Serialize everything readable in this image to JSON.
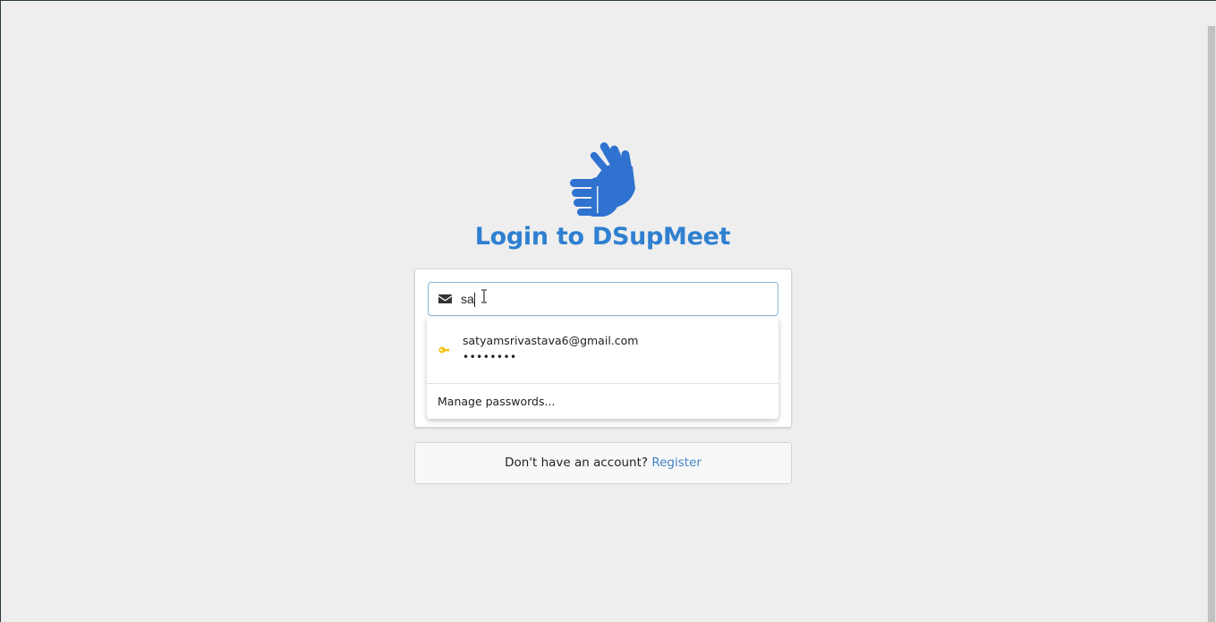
{
  "page": {
    "title": "Login to DSupMeet"
  },
  "login_form": {
    "email_value": "sa",
    "email_icon": "envelope-icon"
  },
  "autofill": {
    "suggestions": [
      {
        "email": "satyamsrivastava6@gmail.com",
        "password_mask": "••••••••",
        "icon": "key-icon"
      }
    ],
    "manage_label": "Manage passwords..."
  },
  "register": {
    "prompt": "Don't have an account?",
    "link_label": "Register"
  },
  "colors": {
    "brand": "#2f80d1",
    "link": "#4183c4",
    "background": "#eeeeee",
    "key_icon": "#f4c20d"
  }
}
